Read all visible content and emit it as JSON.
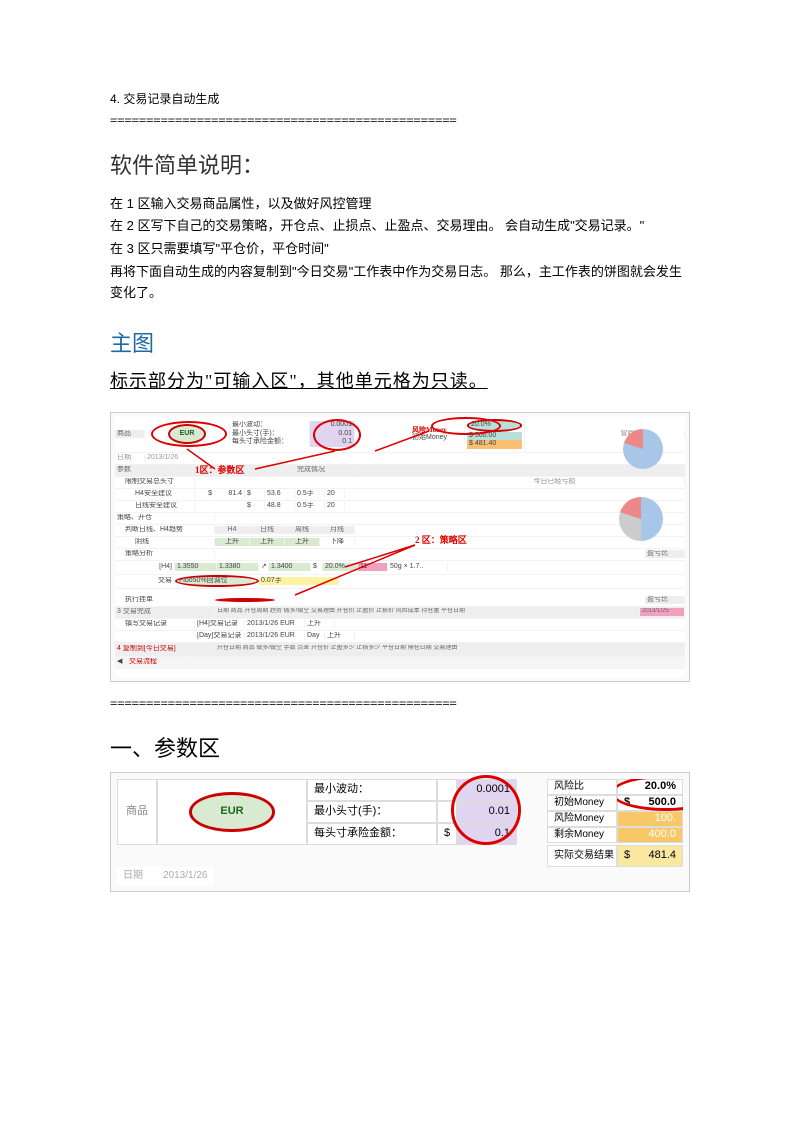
{
  "top_item": "4.   交易记录自动生成",
  "divider": "================================================",
  "title": "软件简单说明：",
  "p1": "在 1 区输入交易商品属性，以及做好风控管理",
  "p2": "在 2 区写下自己的交易策略，开仓点、止损点、止盈点、交易理由。     会自动生成\"交易记录。\"",
  "p3": "在 3 区只需要填写\"平仓价，平仓时间\"",
  "p4": "再将下面自动生成的内容复制到\"今日交易\"工作表中作为交易日志。     那么，主工作表的饼图就会发生变化了。",
  "h2a": "主图",
  "h2a_sub": "标示部分为\"可输入区\"，其他单元格为只读。",
  "mini": {
    "eur": "EUR",
    "commodity": "商品",
    "date_label": "日期",
    "date_val": "2013/1/26",
    "zone1_label": "1区：参数区",
    "zone2_label": "2 区：策略区",
    "min_move": "最小波动：",
    "min_lot": "最小头寸(手)：",
    "lot_amount": "每头寸承险金额：",
    "val_0001": "0.0001",
    "val_001": "0.01",
    "val_01": "0.1",
    "risk_ratio": "20.0%",
    "money": "500.00",
    "risk_money_label": "风险Money",
    "init_money_label": "初始Money",
    "dollar": "$",
    "chart1_title": "冒险比例",
    "chart2_title": "今日已经亏损",
    "section_param": "参数",
    "section_complete": "完成情况",
    "section_plan": "策略、开仓",
    "section_trend": "判断日线、H4趋势",
    "section_analysis": "策略分析",
    "section_exec": "执行挂单",
    "section_done": "3 交易完成",
    "section_copy": "4 复制到[今日交易]",
    "fill_record": "镇写交易记录",
    "total_lots": "限制交易总头寸",
    "h4_safe": "H4安全建议",
    "day_safe": "日线安全建议",
    "h4": "H4",
    "day": "日线",
    "week": "周线",
    "month": "月线",
    "up": "上升",
    "down": "下降",
    "fibo": "Fibo50%回调位",
    "ratio_label": "盈亏比",
    "val_481": "481.40",
    "val_814": "81.4",
    "v_13550": "1.3550",
    "v_13380": "1.3380",
    "v_13400": "1.3400",
    "v_20pct": "20.0%",
    "cols": "日期    商品    开仓周期    趋势    做多/做空    交易理由    开仓价    止盈价    止损价    风险成本    持仓量    平仓日期",
    "tab": "交易流程",
    "date_close": "2013/1/25",
    "record_date": "2013/1/26 EUR",
    "sheet_day": "Day"
  },
  "divider2": "================================================",
  "h2b": "一、参数区",
  "big": {
    "commodity": "商品",
    "eur": "EUR",
    "r1_label": "最小波动：",
    "r1_val": "0.0001",
    "r2_label": "最小头寸(手)：",
    "r2_val": "0.01",
    "r3_label": "每头寸承险金额：",
    "r3_prefix": "$",
    "r3_val": "0.1",
    "risk_ratio_label": "风险比",
    "risk_ratio_val": "20.0%",
    "init_money_label": "初始Money",
    "init_money_prefix": "$",
    "init_money_val": "500.0",
    "risk_money_label": "风险Money",
    "risk_money_val": "100.",
    "remain_money_label": "剩余Money",
    "remain_money_val": "400.0",
    "actual_label": "实际交易结果",
    "actual_prefix": "$",
    "actual_val": "481.4",
    "date_label": "日期",
    "date_val": "2013/1/26"
  }
}
